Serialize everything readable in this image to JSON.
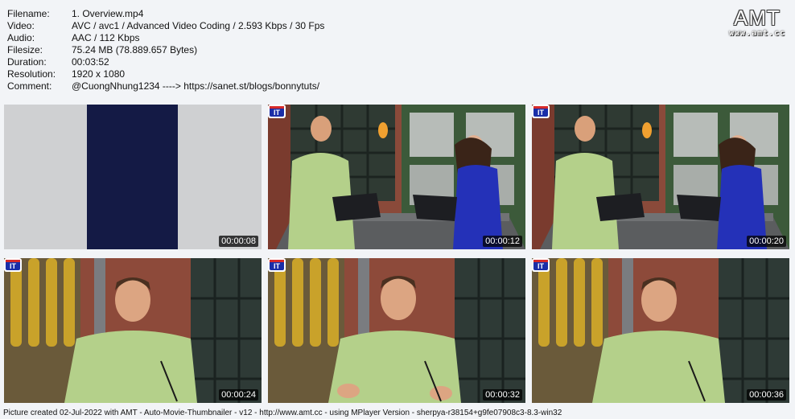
{
  "meta": [
    {
      "label": "Filename:",
      "value": "1. Overview.mp4"
    },
    {
      "label": "Video:",
      "value": "AVC / avc1 / Advanced Video Coding / 2.593 Kbps / 30 Fps"
    },
    {
      "label": "Audio:",
      "value": "AAC / 112 Kbps"
    },
    {
      "label": "Filesize:",
      "value": "75.24 MB (78.889.657 Bytes)"
    },
    {
      "label": "Duration:",
      "value": "00:03:52"
    },
    {
      "label": "Resolution:",
      "value": "1920 x 1080"
    },
    {
      "label": "Comment:",
      "value": "@CuongNhung1234 ----> https://sanet.st/blogs/bonnytuts/"
    }
  ],
  "logo": {
    "title": "AMT",
    "url": "www.amt.cc"
  },
  "thumbnails": [
    {
      "time": "00:00:08",
      "scene": "color-bars"
    },
    {
      "time": "00:00:12",
      "scene": "two-hosts"
    },
    {
      "time": "00:00:20",
      "scene": "two-hosts"
    },
    {
      "time": "00:00:24",
      "scene": "host-closeup"
    },
    {
      "time": "00:00:32",
      "scene": "host-closeup"
    },
    {
      "time": "00:00:36",
      "scene": "host-closeup"
    }
  ],
  "channel_badge": "IT",
  "footer": "Picture created 02-Jul-2022 with AMT - Auto-Movie-Thumbnailer - v12 - http://www.amt.cc - using MPlayer Version - sherpya-r38154+g9fe07908c3-8.3-win32"
}
